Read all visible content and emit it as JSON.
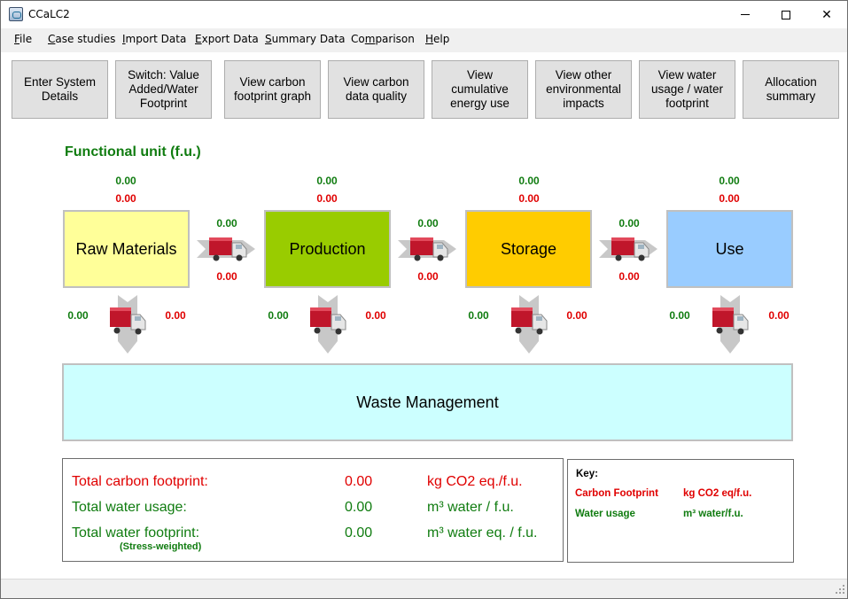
{
  "window": {
    "title": "CCaLC2",
    "controls": {
      "minimize": "minimize",
      "maximize": "maximize",
      "close": "close"
    }
  },
  "menu": [
    {
      "label": "File",
      "accel": "F",
      "rest": "ile"
    },
    {
      "label": "Case studies",
      "accel": "C",
      "rest": "ase studies"
    },
    {
      "label": "Import Data",
      "accel": "I",
      "rest": "mport Data"
    },
    {
      "label": "Export Data",
      "accel": "E",
      "rest": "xport Data"
    },
    {
      "label": "Summary Data",
      "accel": "S",
      "rest": "ummary Data"
    },
    {
      "label": "Comparison",
      "pre": "Co",
      "accel": "m",
      "rest": "parison"
    },
    {
      "label": "Help",
      "accel": "H",
      "rest": "elp"
    }
  ],
  "toolbar": [
    {
      "label": "Enter System\nDetails"
    },
    {
      "label": "Switch: Value\nAdded/Water\nFootprint"
    },
    {
      "label": "View carbon\nfootprint graph"
    },
    {
      "label": "View carbon\ndata quality"
    },
    {
      "label": "View\ncumulative\nenergy use"
    },
    {
      "label": "View other\nenvironmental\nimpacts"
    },
    {
      "label": "View water\nusage / water\nfootprint"
    },
    {
      "label": "Allocation\nsummary"
    }
  ],
  "functional_unit_label": "Functional unit (f.u.)",
  "stages": [
    {
      "name": "Raw Materials",
      "color": "#ffff99",
      "water": "0.00",
      "carbon": "0.00"
    },
    {
      "name": "Production",
      "color": "#99cc00",
      "water": "0.00",
      "carbon": "0.00"
    },
    {
      "name": "Storage",
      "color": "#ffcc00",
      "water": "0.00",
      "carbon": "0.00"
    },
    {
      "name": "Use",
      "color": "#99ccff",
      "water": "0.00",
      "carbon": "0.00"
    }
  ],
  "transport_between": [
    {
      "water": "0.00",
      "carbon": "0.00"
    },
    {
      "water": "0.00",
      "carbon": "0.00"
    },
    {
      "water": "0.00",
      "carbon": "0.00"
    }
  ],
  "transport_to_waste": [
    {
      "water": "0.00",
      "carbon": "0.00"
    },
    {
      "water": "0.00",
      "carbon": "0.00"
    },
    {
      "water": "0.00",
      "carbon": "0.00"
    },
    {
      "water": "0.00",
      "carbon": "0.00"
    }
  ],
  "waste_management": {
    "label": "Waste Management",
    "color": "#ccffff"
  },
  "totals": {
    "carbon": {
      "label": "Total carbon footprint:",
      "value": "0.00",
      "unit": "kg CO2 eq./f.u."
    },
    "water_usage": {
      "label": "Total water usage:",
      "value": "0.00",
      "unit": "m³ water / f.u."
    },
    "water_footprint": {
      "label": "Total water footprint:",
      "sublabel": "(Stress-weighted)",
      "value": "0.00",
      "unit": "m³ water eq. / f.u."
    }
  },
  "key": {
    "title": "Key:",
    "carbon": {
      "label": "Carbon Footprint",
      "unit": "kg CO2 eq/f.u."
    },
    "water": {
      "label": "Water usage",
      "unit": "m³ water/f.u."
    }
  },
  "colors": {
    "carbon": "#e00000",
    "water": "#107c10"
  }
}
